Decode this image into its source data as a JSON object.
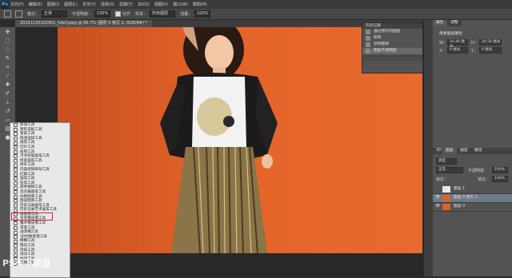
{
  "app": {
    "logo": "Ps"
  },
  "menu": [
    "文件(F)",
    "编辑(E)",
    "图像(I)",
    "图层(L)",
    "文字(Y)",
    "选择(S)",
    "滤镜(T)",
    "3D(D)",
    "视图(V)",
    "窗口(W)",
    "帮助(H)"
  ],
  "options": {
    "mode_label": "模式：",
    "mode_value": "正常",
    "opacity_label": "不透明度：",
    "opacity_value": "100%",
    "erase_history_label": "抹到历史记录",
    "flow_label": "流量：",
    "flow_value": "100%",
    "align_label": "对齐",
    "sample_label": "样本：",
    "sample_value": "所有图层"
  },
  "document": {
    "tab_title": "20151125202901_5AeY.jpeg @ 66.7% (图层 0 拷贝 2, RGB/8#) *"
  },
  "tools": [
    "move",
    "marquee",
    "lasso",
    "quick-select",
    "crop",
    "eyedropper",
    "healing",
    "brush",
    "clone-stamp",
    "history-brush",
    "eraser",
    "gradient",
    "blur",
    "dodge",
    "pen",
    "type",
    "path-select",
    "shape",
    "hand",
    "zoom"
  ],
  "tool_flyout": {
    "items": [
      "移动工具",
      "矩形选框工具",
      "套索工具",
      "快速选择工具",
      "裁剪工具",
      "切片工具",
      "吸管工具",
      "污点修复画笔工具",
      "修复画笔工具",
      "修补工具",
      "内容感知移动工具",
      "红眼工具",
      "画笔工具",
      "铅笔工具",
      "颜色替换工具",
      "混合器画笔工具",
      "仿制图章工具",
      "图案图章工具",
      "历史记录画笔工具",
      "历史记录艺术画笔工具",
      "橡皮擦工具",
      "背景橡皮擦工具",
      "魔术橡皮擦工具",
      "渐变工具",
      "油漆桶工具",
      "3D材质拖放工具",
      "模糊工具",
      "锐化工具",
      "涂抹工具",
      "减淡工具",
      "加深工具",
      "海绵工具"
    ],
    "highlighted_index": 20
  },
  "history_panel": {
    "title": "历史记录",
    "items": [
      "通过拷贝的图层",
      "修改",
      "仿制图章",
      "图层不透明度"
    ],
    "active_index": 3
  },
  "right_panels": {
    "tabs_top": [
      "属性",
      "调整"
    ],
    "properties": {
      "title": "像素图层属性",
      "w_label": "W：",
      "w_value": "14.48 厘米",
      "h_label": "H：",
      "h_value": "24.58 厘米",
      "x_label": "X：",
      "x_value": "0 厘米",
      "y_label": "Y：",
      "y_value": "0 厘米"
    },
    "tabs_layers": [
      "3D",
      "图层",
      "通道",
      "路径"
    ],
    "layer_filter": "类型",
    "blend_mode": "正常",
    "opacity_label": "不透明度：",
    "opacity_value": "100%",
    "lock_label": "锁定：",
    "fill_label": "填充：",
    "fill_value": "100%",
    "layers": [
      {
        "name": "图层 1"
      },
      {
        "name": "图层 0 拷贝 2"
      },
      {
        "name": "图层 0"
      }
    ]
  },
  "watermark": "PS天下联盟",
  "colors": {
    "accent": "#4fb2ff",
    "panel": "#535353",
    "highlight": "#d02020"
  }
}
